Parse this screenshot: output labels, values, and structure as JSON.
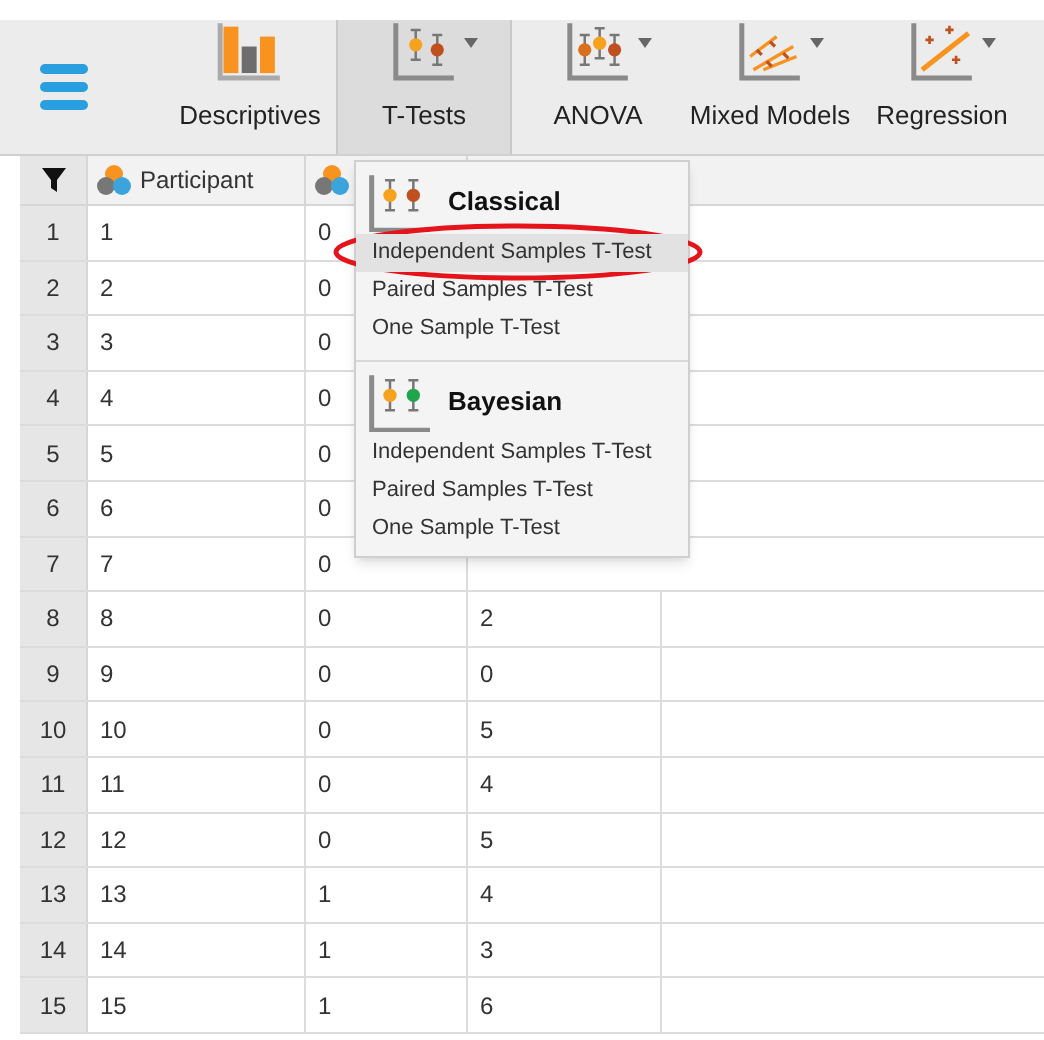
{
  "toolbar": {
    "buttons": [
      {
        "label": "Descriptives",
        "kind": "bars",
        "selected": false,
        "has_menu": false
      },
      {
        "label": "T-Tests",
        "kind": "ttest",
        "selected": true,
        "has_menu": true
      },
      {
        "label": "ANOVA",
        "kind": "anova",
        "selected": false,
        "has_menu": true
      },
      {
        "label": "Mixed Models",
        "kind": "mixed",
        "selected": false,
        "has_menu": true
      },
      {
        "label": "Regression",
        "kind": "regression",
        "selected": false,
        "has_menu": true
      }
    ]
  },
  "table": {
    "columns": [
      {
        "kind": "filter"
      },
      {
        "kind": "scale",
        "label": "Participant"
      },
      {
        "kind": "nominal"
      }
    ],
    "rows": [
      {
        "number": "1",
        "cells": [
          "1",
          "0"
        ]
      },
      {
        "number": "2",
        "cells": [
          "2",
          "0"
        ]
      },
      {
        "number": "3",
        "cells": [
          "3",
          "0"
        ]
      },
      {
        "number": "4",
        "cells": [
          "4",
          "0"
        ]
      },
      {
        "number": "5",
        "cells": [
          "5",
          "0"
        ]
      },
      {
        "number": "6",
        "cells": [
          "6",
          "0"
        ]
      },
      {
        "number": "7",
        "cells": [
          "7",
          "0"
        ]
      },
      {
        "number": "8",
        "cells": [
          "8",
          "0",
          "2"
        ]
      },
      {
        "number": "9",
        "cells": [
          "9",
          "0",
          "0"
        ]
      },
      {
        "number": "10",
        "cells": [
          "10",
          "0",
          "5"
        ]
      },
      {
        "number": "11",
        "cells": [
          "11",
          "0",
          "4"
        ]
      },
      {
        "number": "12",
        "cells": [
          "12",
          "0",
          "5"
        ]
      },
      {
        "number": "13",
        "cells": [
          "13",
          "1",
          "4"
        ]
      },
      {
        "number": "14",
        "cells": [
          "14",
          "1",
          "3"
        ]
      },
      {
        "number": "15",
        "cells": [
          "15",
          "1",
          "6"
        ]
      }
    ]
  },
  "menu": {
    "sections": [
      {
        "title": "Classical",
        "kind": "classical",
        "items": [
          {
            "label": "Independent Samples T-Test",
            "selected": true,
            "circled": true
          },
          {
            "label": "Paired Samples T-Test",
            "selected": false,
            "circled": false
          },
          {
            "label": "One Sample T-Test",
            "selected": false,
            "circled": false
          }
        ]
      },
      {
        "title": "Bayesian",
        "kind": "bayesian",
        "items": [
          {
            "label": "Independent Samples T-Test",
            "selected": false,
            "circled": false
          },
          {
            "label": "Paired Samples T-Test",
            "selected": false,
            "circled": false
          },
          {
            "label": "One Sample T-Test",
            "selected": false,
            "circled": false
          }
        ]
      }
    ]
  }
}
